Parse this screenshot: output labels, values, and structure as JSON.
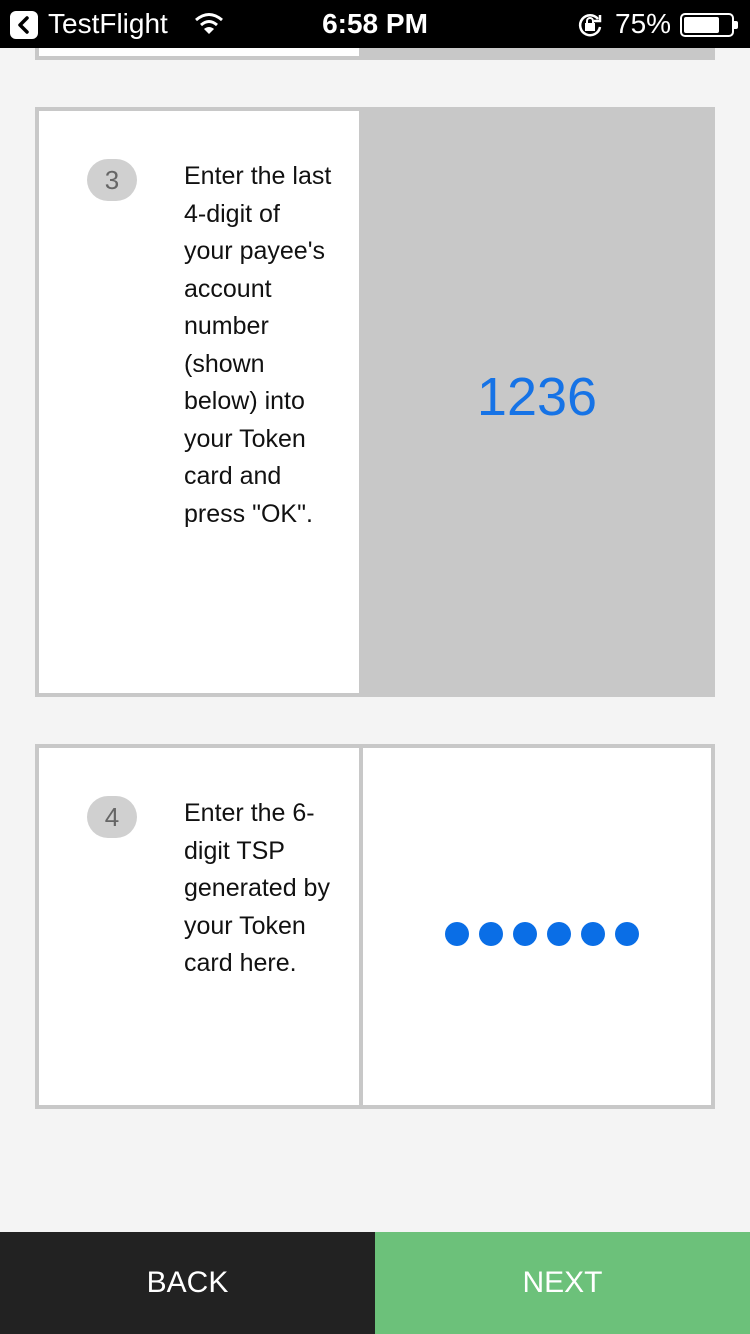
{
  "status_bar": {
    "app": "TestFlight",
    "time": "6:58 PM",
    "battery_percent": "75%",
    "battery_level": 0.75,
    "icons": [
      "back-chevron-icon",
      "wifi-icon",
      "rotation-lock-icon",
      "battery-icon"
    ]
  },
  "step3": {
    "number": "3",
    "instruction": "Enter the last 4-digit of your payee's account number (shown below) into your Token card and press \"OK\".",
    "account_digits": "1236"
  },
  "step4": {
    "number": "4",
    "instruction": "Enter the 6-digit TSP generated by your Token card here.",
    "tsp_filled": 6
  },
  "buttons": {
    "back": "BACK",
    "next": "NEXT"
  },
  "colors": {
    "accent_blue": "#1673e6",
    "next_green": "#6cc17a",
    "back_dark": "#222222",
    "card_grey": "#c8c8c8"
  }
}
